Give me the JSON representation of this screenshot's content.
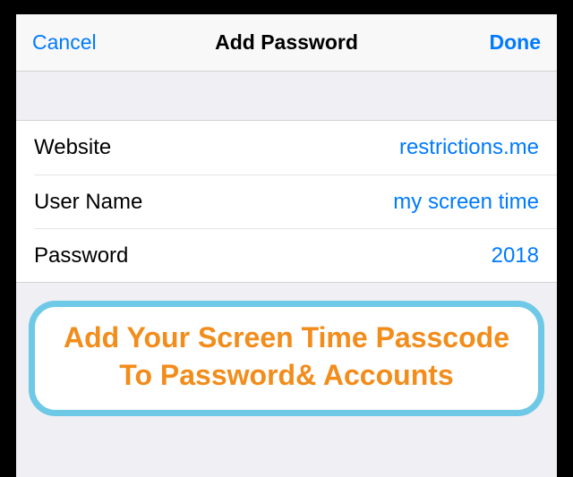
{
  "nav": {
    "cancel": "Cancel",
    "title": "Add Password",
    "done": "Done"
  },
  "fields": {
    "website": {
      "label": "Website",
      "value": "restrictions.me"
    },
    "username": {
      "label": "User Name",
      "value": "my screen time"
    },
    "password": {
      "label": "Password",
      "value": "2018"
    }
  },
  "callout": {
    "text": "Add Your Screen Time Passcode To Password& Accounts"
  },
  "colors": {
    "accent": "#007aff",
    "callout_border": "#6ec9e6",
    "callout_text": "#f28c1b"
  }
}
